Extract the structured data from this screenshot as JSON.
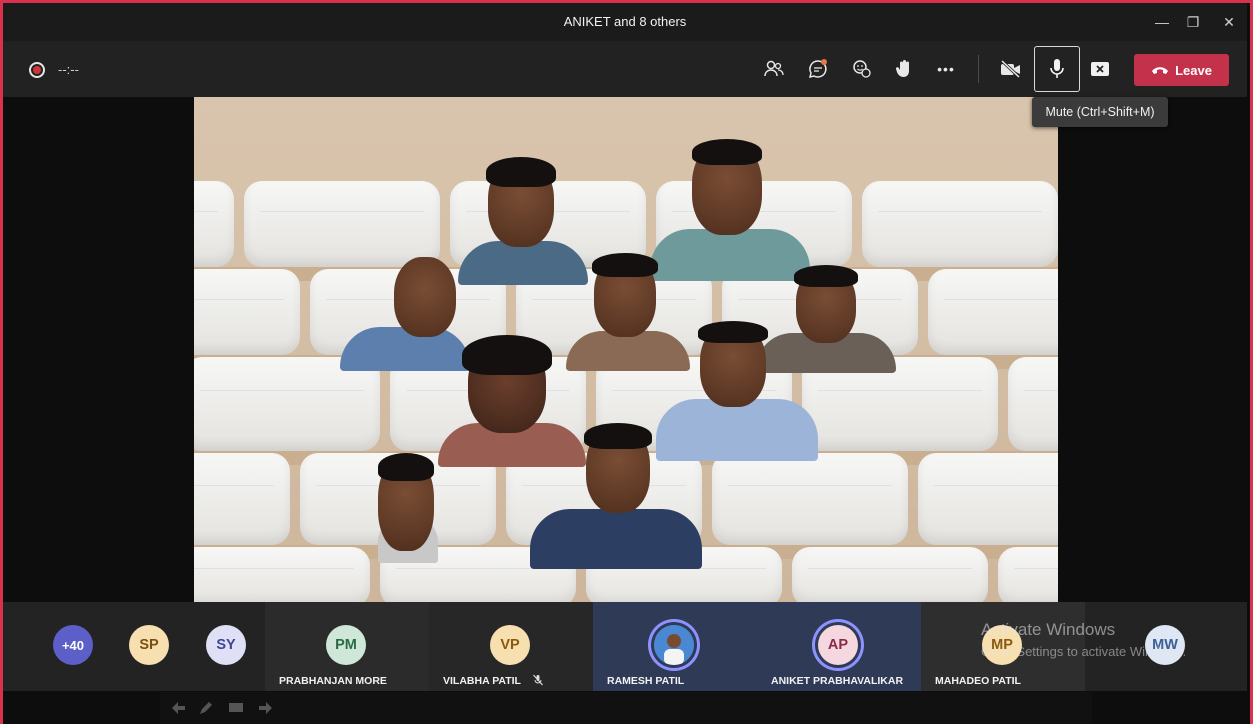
{
  "window": {
    "title": "ANIKET and 8 others",
    "minimize_glyph": "—",
    "maximize_glyph": "❐",
    "close_glyph": "✕"
  },
  "toolbar": {
    "timer": "--:--",
    "leave_label": "Leave",
    "more_glyph": "•••",
    "buttons": [
      "people-icon",
      "chat-icon",
      "reactions-icon",
      "raise-hand-icon",
      "more-options-icon",
      "camera-off-icon",
      "microphone-icon",
      "share-tray-icon"
    ]
  },
  "tooltip": {
    "text": "Mute (Ctrl+Shift+M)"
  },
  "roster": {
    "overflow": "+40",
    "participants": [
      {
        "initials": "SP",
        "name": ""
      },
      {
        "initials": "SY",
        "name": ""
      },
      {
        "initials": "PM",
        "name": "PRABHANJAN MORE"
      },
      {
        "initials": "VP",
        "name": "VILABHA PATIL",
        "muted": true
      },
      {
        "initials": "",
        "name": "RAMESH PATIL"
      },
      {
        "initials": "AP",
        "name": "ANIKET PRABHAVALIKAR"
      },
      {
        "initials": "MP",
        "name": "MAHADEO PATIL"
      },
      {
        "initials": "MW",
        "name": ""
      }
    ]
  },
  "watermark": {
    "title": "Activate Windows",
    "subtitle": "Go to Settings to activate Windows."
  },
  "colors": {
    "accent_red": "#c4314b",
    "border_red": "#d8324f",
    "overflow_bg": "#5b5fc7",
    "speaker_ring": "#8e92ff"
  }
}
